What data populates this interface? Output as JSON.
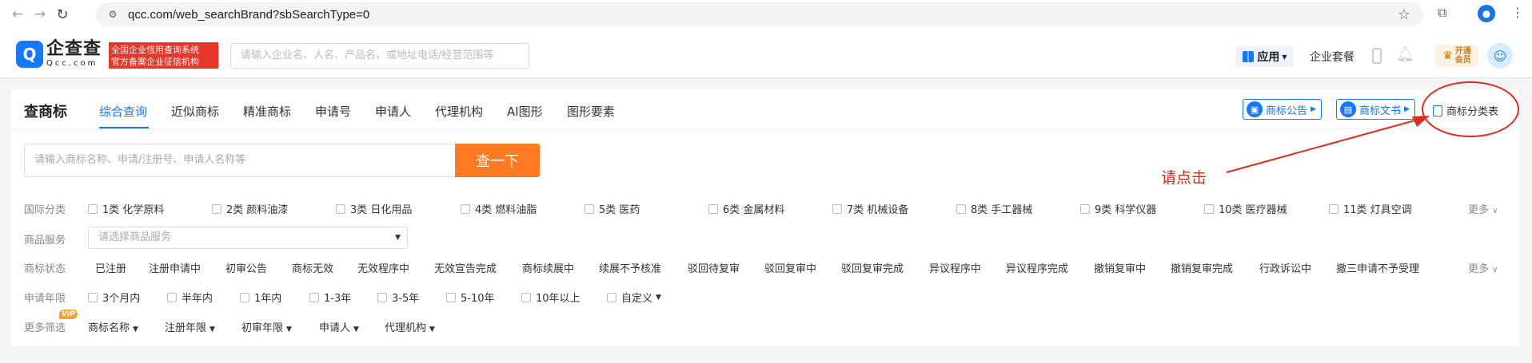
{
  "browser": {
    "url": "qcc.com/web_searchBrand?sbSearchType=0"
  },
  "header": {
    "logo_cn": "企查查",
    "logo_en": "Qcc.com",
    "badge_line1": "全国企业信用查询系统",
    "badge_line2": "官方备案企业征信机构",
    "search_placeholder": "请输入企业名、人名、产品名、或地址电话/经营范围等",
    "app_label": "应用",
    "suite_label": "企业套餐",
    "vip_line1": "开通",
    "vip_line2": "会员"
  },
  "tabs": {
    "title": "查商标",
    "items": [
      "综合查询",
      "近似商标",
      "精准商标",
      "申请号",
      "申请人",
      "代理机构",
      "AI图形",
      "图形要素"
    ],
    "active": "综合查询"
  },
  "quick_links": {
    "announcement": "商标公告",
    "documents": "商标文书",
    "classification": "商标分类表"
  },
  "search": {
    "placeholder": "请输入商标名称、申请/注册号、申请人名称等",
    "button": "查一下"
  },
  "annotation": {
    "text": "请点击"
  },
  "filters": {
    "intl_class": {
      "label": "国际分类",
      "options": [
        "1类 化学原料",
        "2类 颜料油漆",
        "3类 日化用品",
        "4类 燃料油脂",
        "5类 医药",
        "6类 金属材料",
        "7类 机械设备",
        "8类 手工器械",
        "9类 科学仪器",
        "10类 医疗器械",
        "11类 灯具空调"
      ],
      "more": "更多"
    },
    "goods_service": {
      "label": "商品服务",
      "placeholder": "请选择商品服务"
    },
    "status": {
      "label": "商标状态",
      "options": [
        "已注册",
        "注册申请中",
        "初审公告",
        "商标无效",
        "无效程序中",
        "无效宣告完成",
        "商标续展中",
        "续展不予核准",
        "驳回待复审",
        "驳回复审中",
        "驳回复审完成",
        "异议程序中",
        "异议程序完成",
        "撤销复审中",
        "撤销复审完成",
        "行政诉讼中",
        "撤三申请不予受理"
      ],
      "more": "更多"
    },
    "years": {
      "label": "申请年限",
      "options": [
        "3个月内",
        "半年内",
        "1年内",
        "1-3年",
        "3-5年",
        "5-10年",
        "10年以上",
        "自定义"
      ]
    },
    "more_filters": {
      "label": "更多筛选",
      "vip": "VIP",
      "dropdowns": [
        "商标名称",
        "注册年限",
        "初审年限",
        "申请人",
        "代理机构"
      ]
    }
  }
}
